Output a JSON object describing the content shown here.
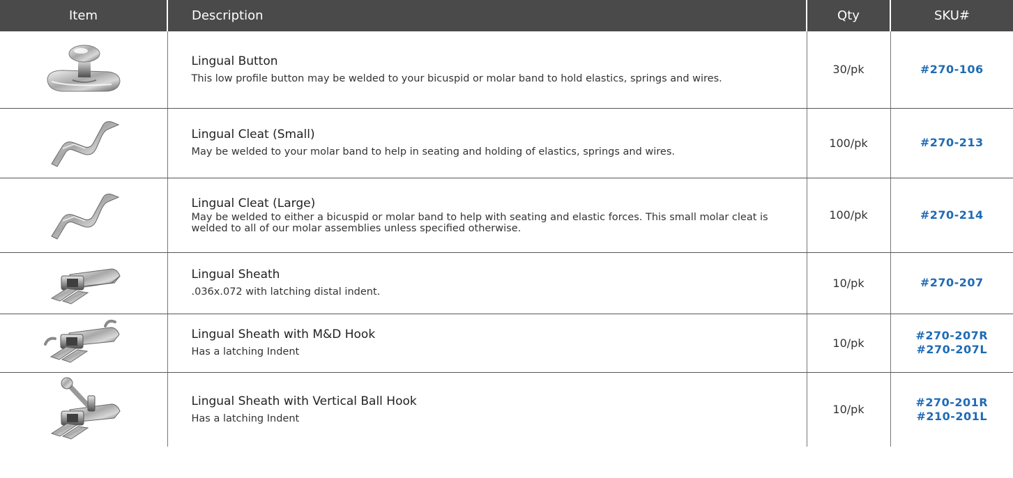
{
  "headers": {
    "item": "Item",
    "description": "Description",
    "qty": "Qty",
    "sku": "SKU#"
  },
  "products": [
    {
      "icon": "lingual-button-icon",
      "name": "Lingual Button",
      "description": "This low profile button may be welded to your bicuspid or molar band to hold elastics, springs and wires.",
      "qty": "30/pk",
      "sku": [
        "#270-106"
      ]
    },
    {
      "icon": "lingual-cleat-icon",
      "name": "Lingual Cleat (Small)",
      "description": "May be welded to your molar band to help in seating and holding of elastics, springs and wires.",
      "qty": "100/pk",
      "sku": [
        "#270-213"
      ]
    },
    {
      "icon": "lingual-cleat-icon",
      "name": "Lingual Cleat (Large)",
      "description": "May be welded to either a bicuspid or molar band to help with seating and elastic forces. This small molar cleat is welded to all of our molar assemblies unless specified otherwise.",
      "qty": "100/pk",
      "sku": [
        "#270-214"
      ]
    },
    {
      "icon": "lingual-sheath-icon",
      "name": "Lingual Sheath",
      "description": ".036x.072 with latching distal indent.",
      "qty": "10/pk",
      "sku": [
        "#270-207"
      ]
    },
    {
      "icon": "lingual-sheath-md-hook-icon",
      "name": "Lingual Sheath with M&D Hook",
      "description": "Has a latching Indent",
      "qty": "10/pk",
      "sku": [
        "#270-207R",
        "#270-207L"
      ]
    },
    {
      "icon": "lingual-sheath-ball-hook-icon",
      "name": "Lingual Sheath with Vertical Ball Hook",
      "description": "Has a latching Indent",
      "qty": "10/pk",
      "sku": [
        "#270-201R",
        "#210-201L"
      ]
    }
  ],
  "colors": {
    "header_bg": "#4a4a4a",
    "sku_blue": "#1f6bb5"
  }
}
